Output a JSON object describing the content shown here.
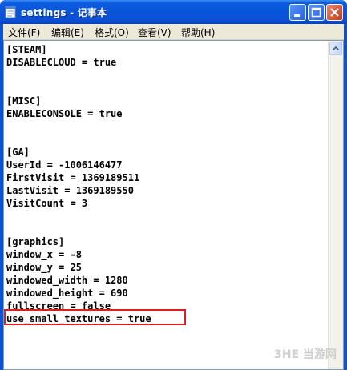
{
  "window": {
    "title": "settings - 记事本"
  },
  "menu": {
    "items": [
      {
        "label": "文件(F)"
      },
      {
        "label": "编辑(E)"
      },
      {
        "label": "格式(O)"
      },
      {
        "label": "查看(V)"
      },
      {
        "label": "帮助(H)"
      }
    ]
  },
  "editor": {
    "lines": [
      "[STEAM]",
      "DISABLECLOUD = true",
      "",
      "",
      "[MISC]",
      "ENABLECONSOLE = true",
      "",
      "",
      "[GA]",
      "UserId = -1006146477",
      "FirstVisit = 1369189511",
      "LastVisit = 1369189550",
      "VisitCount = 3",
      "",
      "",
      "[graphics]",
      "window_x = -8",
      "window_y = 25",
      "windowed_width = 1280",
      "windowed_height = 690",
      "fullscreen = false",
      "use_small_textures = true"
    ],
    "highlighted_line": "use_small_textures = true"
  },
  "watermark": {
    "text": "3HE 当游网"
  },
  "colors": {
    "titlebar": "#0a55d8",
    "highlight": "#e21b1b",
    "menubar": "#ece9d8"
  }
}
